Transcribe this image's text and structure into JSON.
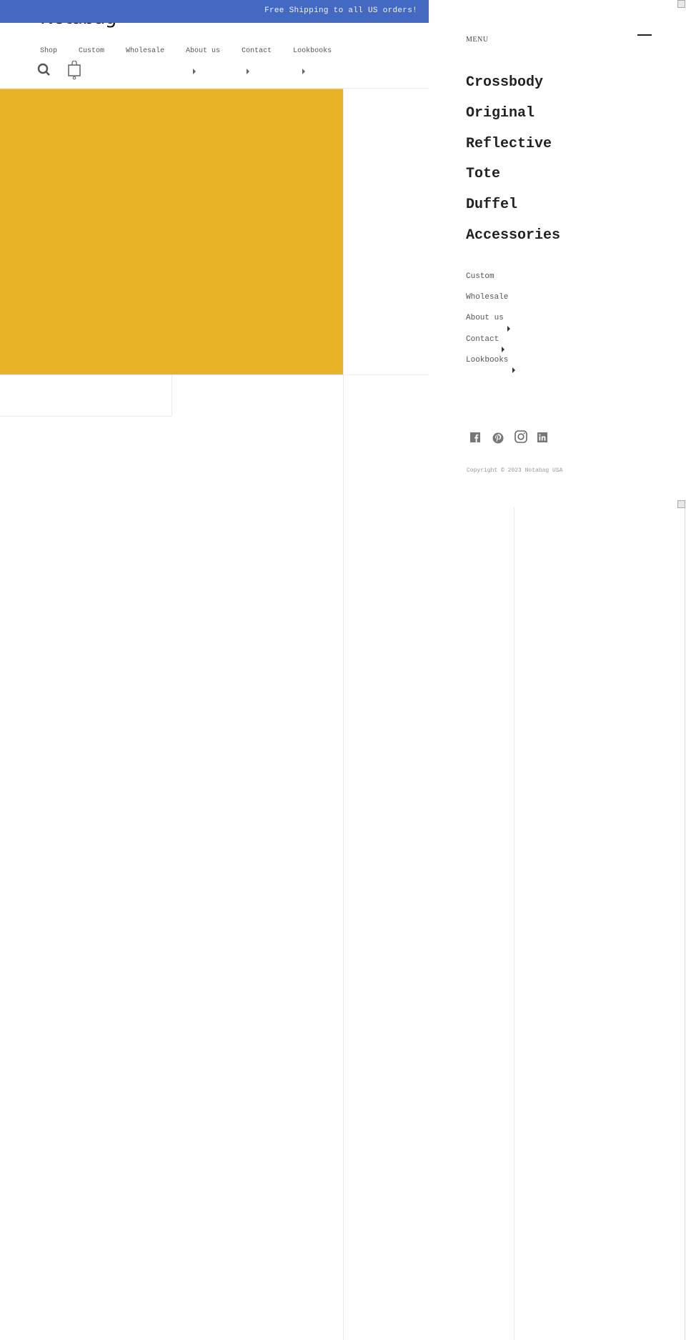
{
  "announcement": {
    "text": "Free Shipping to all US orders!"
  },
  "header": {
    "logo": "Notabag",
    "nav": [
      {
        "label": "Shop",
        "has_caret": false
      },
      {
        "label": "Custom",
        "has_caret": false
      },
      {
        "label": "Wholesale",
        "has_caret": false
      },
      {
        "label": "About us",
        "has_caret": true
      },
      {
        "label": "Contact",
        "has_caret": true
      },
      {
        "label": "Lookbooks",
        "has_caret": true
      }
    ],
    "icons": [
      "search-icon",
      "shopping-bag-icon"
    ]
  },
  "hero": {
    "color": "#e8b327"
  },
  "drawer": {
    "title": "MENU",
    "close_icon": "close-bar-icon",
    "categories": [
      "Crossbody",
      "Original",
      "Reflective",
      "Tote",
      "Duffel",
      "Accessories"
    ],
    "links": [
      {
        "label": "Custom",
        "has_caret": false
      },
      {
        "label": "Wholesale",
        "has_caret": false
      },
      {
        "label": "About us",
        "has_caret": true
      },
      {
        "label": "Contact",
        "has_caret": true
      },
      {
        "label": "Lookbooks",
        "has_caret": true
      }
    ],
    "social": [
      "facebook-icon",
      "pinterest-icon",
      "instagram-icon",
      "linkedin-icon"
    ],
    "copyright": "Copyright © 2023 Notabag USA"
  },
  "colors": {
    "announcement_bg": "#4469c3",
    "hero": "#e8b327"
  }
}
